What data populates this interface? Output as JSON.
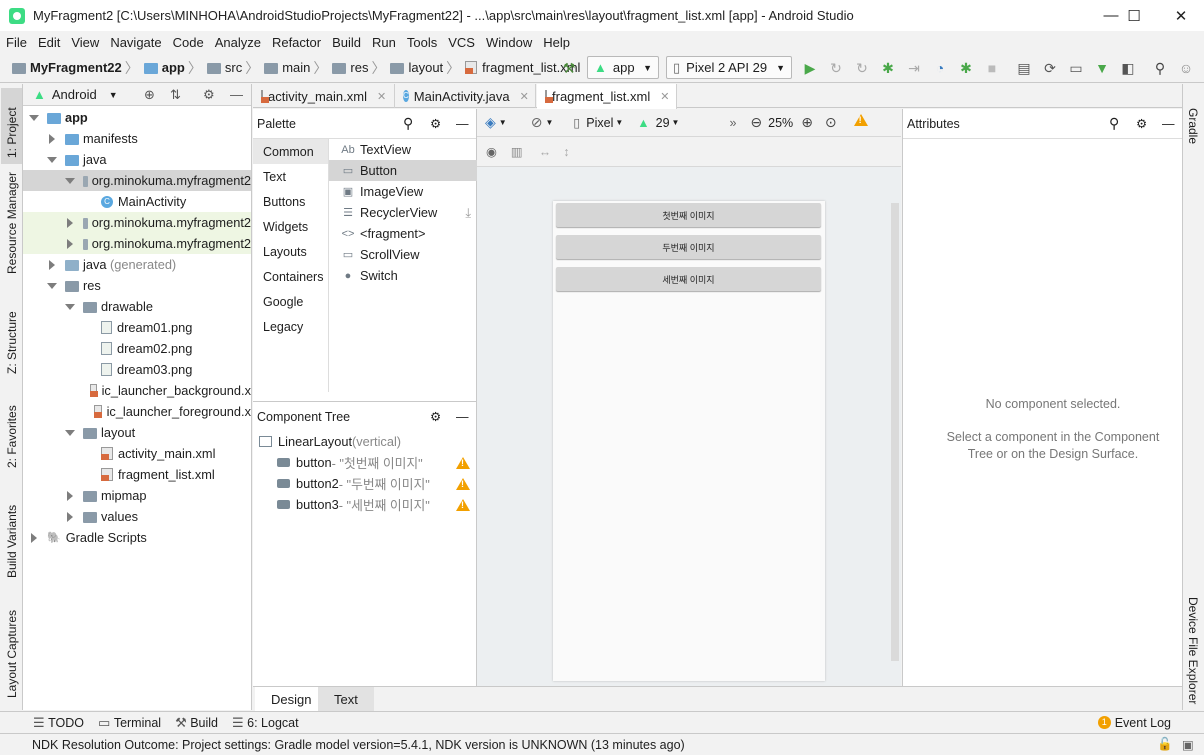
{
  "window": {
    "title": "MyFragment2 [C:\\Users\\MINHOHA\\AndroidStudioProjects\\MyFragment22] - ...\\app\\src\\main\\res\\layout\\fragment_list.xml [app] - Android Studio",
    "minimize": "—",
    "maximize": "☐",
    "close": "✕"
  },
  "menu": [
    "File",
    "Edit",
    "View",
    "Navigate",
    "Code",
    "Analyze",
    "Refactor",
    "Build",
    "Run",
    "Tools",
    "VCS",
    "Window",
    "Help"
  ],
  "breadcrumb": [
    "MyFragment22",
    "app",
    "src",
    "main",
    "res",
    "layout",
    "fragment_list.xml"
  ],
  "toolbar": {
    "config": "app",
    "device": "Pixel 2 API 29"
  },
  "left_strip": [
    "1: Project",
    "Resource Manager",
    "Z: Structure",
    "2: Favorites",
    "Build Variants",
    "Layout Captures"
  ],
  "right_strip": [
    "Gradle",
    "Device File Explorer"
  ],
  "project": {
    "view": "Android",
    "tree": [
      {
        "label": "app",
        "depth": 0,
        "arrow": "down",
        "icon": "folder-blue"
      },
      {
        "label": "manifests",
        "depth": 1,
        "arrow": "right",
        "icon": "folder-blue"
      },
      {
        "label": "java",
        "depth": 1,
        "arrow": "down",
        "icon": "folder-blue"
      },
      {
        "label": "org.minokuma.myfragment2",
        "depth": 2,
        "arrow": "down",
        "icon": "package",
        "state": "selected"
      },
      {
        "label": "MainActivity",
        "depth": 3,
        "arrow": "none",
        "icon": "class"
      },
      {
        "label": "org.minokuma.myfragment2",
        "depth": 2,
        "arrow": "right",
        "icon": "package",
        "state": "highlight"
      },
      {
        "label": "org.minokuma.myfragment2",
        "depth": 2,
        "arrow": "right",
        "icon": "package",
        "state": "highlight"
      },
      {
        "label": "java",
        "suffix": " (generated)",
        "depth": 1,
        "arrow": "right",
        "icon": "folder-gen"
      },
      {
        "label": "res",
        "depth": 1,
        "arrow": "down",
        "icon": "folder"
      },
      {
        "label": "drawable",
        "depth": 2,
        "arrow": "down",
        "icon": "folder"
      },
      {
        "label": "dream01.png",
        "depth": 3,
        "arrow": "none",
        "icon": "png"
      },
      {
        "label": "dream02.png",
        "depth": 3,
        "arrow": "none",
        "icon": "png"
      },
      {
        "label": "dream03.png",
        "depth": 3,
        "arrow": "none",
        "icon": "png"
      },
      {
        "label": "ic_launcher_background.x",
        "depth": 3,
        "arrow": "none",
        "icon": "xml"
      },
      {
        "label": "ic_launcher_foreground.x",
        "depth": 3,
        "arrow": "none",
        "icon": "xml"
      },
      {
        "label": "layout",
        "depth": 2,
        "arrow": "down",
        "icon": "folder"
      },
      {
        "label": "activity_main.xml",
        "depth": 3,
        "arrow": "none",
        "icon": "xml"
      },
      {
        "label": "fragment_list.xml",
        "depth": 3,
        "arrow": "none",
        "icon": "xml"
      },
      {
        "label": "mipmap",
        "depth": 2,
        "arrow": "right",
        "icon": "folder"
      },
      {
        "label": "values",
        "depth": 2,
        "arrow": "right",
        "icon": "folder"
      },
      {
        "label": "Gradle Scripts",
        "depth": 0,
        "arrow": "right",
        "icon": "gradle"
      }
    ]
  },
  "editor_tabs": [
    {
      "label": "activity_main.xml",
      "icon": "xml"
    },
    {
      "label": "MainActivity.java",
      "icon": "class"
    },
    {
      "label": "fragment_list.xml",
      "icon": "xml",
      "active": true
    }
  ],
  "palette": {
    "title": "Palette",
    "categories": [
      "Common",
      "Text",
      "Buttons",
      "Widgets",
      "Layouts",
      "Containers",
      "Google",
      "Legacy"
    ],
    "selected_category": "Common",
    "items": [
      {
        "icon": "Ab",
        "label": "TextView"
      },
      {
        "icon": "▭",
        "label": "Button",
        "selected": true
      },
      {
        "icon": "▣",
        "label": "ImageView"
      },
      {
        "icon": "☰",
        "label": "RecyclerView"
      },
      {
        "icon": "<>",
        "label": "<fragment>"
      },
      {
        "icon": "▭",
        "label": "ScrollView"
      },
      {
        "icon": "●",
        "label": "Switch"
      }
    ]
  },
  "component_tree": {
    "title": "Component Tree",
    "root": {
      "label": "LinearLayout",
      "suffix": "(vertical)"
    },
    "children": [
      {
        "id": "button",
        "text": "- \"첫번째 이미지\""
      },
      {
        "id": "button2",
        "text": "- \"두번째 이미지\""
      },
      {
        "id": "button3",
        "text": "- \"세번째 이미지\""
      }
    ]
  },
  "design": {
    "device": "Pixel",
    "api": "29",
    "zoom": "25%",
    "buttons": [
      "첫번째 이미지",
      "두번째 이미지",
      "세번째 이미지"
    ]
  },
  "attributes": {
    "title": "Attributes",
    "empty_title": "No component selected.",
    "empty_hint": "Select a component in the Component Tree or on the Design Surface."
  },
  "design_tabs": [
    "Design",
    "Text"
  ],
  "bottom_tools": [
    "TODO",
    "Terminal",
    "Build",
    "6: Logcat"
  ],
  "event_log": {
    "count": "1",
    "label": "Event Log"
  },
  "status": "NDK Resolution Outcome: Project settings: Gradle model version=5.4.1, NDK version is UNKNOWN (13 minutes ago)",
  "colors": {
    "accent": "#6aa7d8",
    "warning": "#f2a000",
    "run": "#4aa84a"
  }
}
